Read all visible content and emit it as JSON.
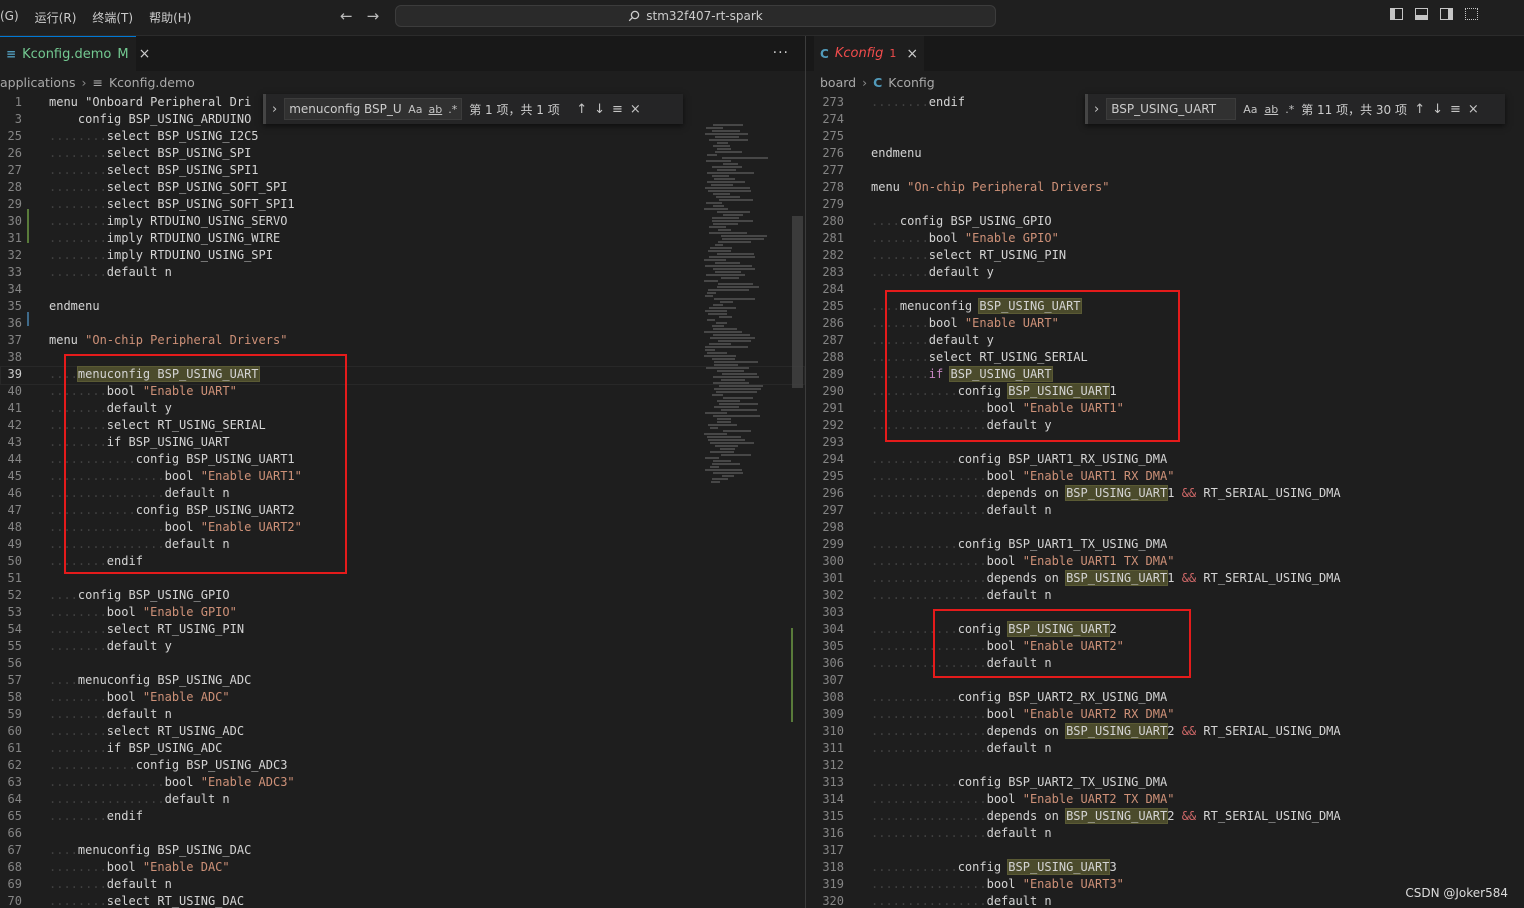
{
  "menubar": {
    "items": [
      "(G)",
      "运行(R)",
      "终端(T)",
      "帮助(H)"
    ]
  },
  "nav": {
    "back": "←",
    "forward": "→"
  },
  "command_center": {
    "label": "stm32f407-rt-spark"
  },
  "left": {
    "tab": {
      "label": "Kconfig.demo",
      "status": "M",
      "close": "×"
    },
    "more": "···",
    "breadcrumb": [
      "applications",
      "Kconfig.demo"
    ],
    "find": {
      "query": "menuconfig BSP_U:",
      "opt_case": "Aa",
      "opt_word": "ab",
      "opt_regex": ".*",
      "result": "第 1 项，共 1 项"
    },
    "lines": [
      {
        "n": "1",
        "t": "menu \"Onboard Peripheral Dri"
      },
      {
        "n": "3",
        "t": "    config BSP_USING_ARDUINO"
      },
      {
        "n": "25",
        "t": "........select BSP_USING_I2C5"
      },
      {
        "n": "26",
        "t": "........select BSP_USING_SPI"
      },
      {
        "n": "27",
        "t": "........select BSP_USING_SPI1"
      },
      {
        "n": "28",
        "t": "........select BSP_USING_SOFT_SPI"
      },
      {
        "n": "29",
        "t": "........select BSP_USING_SOFT_SPI1"
      },
      {
        "n": "30",
        "t": "........imply RTDUINO_USING_SERVO"
      },
      {
        "n": "31",
        "t": "........imply RTDUINO_USING_WIRE"
      },
      {
        "n": "32",
        "t": "........imply RTDUINO_USING_SPI"
      },
      {
        "n": "33",
        "t": "........default n"
      },
      {
        "n": "34",
        "t": ""
      },
      {
        "n": "35",
        "t": "endmenu"
      },
      {
        "n": "36",
        "t": ""
      },
      {
        "n": "37",
        "t": "menu \"On-chip Peripheral Drivers\""
      },
      {
        "n": "38",
        "t": ""
      },
      {
        "n": "39",
        "t": "....menuconfig BSP_USING_UART"
      },
      {
        "n": "40",
        "t": "........bool \"Enable UART\""
      },
      {
        "n": "41",
        "t": "........default y"
      },
      {
        "n": "42",
        "t": "........select RT_USING_SERIAL"
      },
      {
        "n": "43",
        "t": "........if BSP_USING_UART"
      },
      {
        "n": "44",
        "t": "............config BSP_USING_UART1"
      },
      {
        "n": "45",
        "t": "................bool \"Enable UART1\""
      },
      {
        "n": "46",
        "t": "................default n"
      },
      {
        "n": "47",
        "t": "............config BSP_USING_UART2"
      },
      {
        "n": "48",
        "t": "................bool \"Enable UART2\""
      },
      {
        "n": "49",
        "t": "................default n"
      },
      {
        "n": "50",
        "t": "........endif"
      },
      {
        "n": "51",
        "t": ""
      },
      {
        "n": "52",
        "t": "....config BSP_USING_GPIO"
      },
      {
        "n": "53",
        "t": "........bool \"Enable GPIO\""
      },
      {
        "n": "54",
        "t": "........select RT_USING_PIN"
      },
      {
        "n": "55",
        "t": "........default y"
      },
      {
        "n": "56",
        "t": ""
      },
      {
        "n": "57",
        "t": "....menuconfig BSP_USING_ADC"
      },
      {
        "n": "58",
        "t": "........bool \"Enable ADC\""
      },
      {
        "n": "59",
        "t": "........default n"
      },
      {
        "n": "60",
        "t": "........select RT_USING_ADC"
      },
      {
        "n": "61",
        "t": "........if BSP_USING_ADC"
      },
      {
        "n": "62",
        "t": "............config BSP_USING_ADC3"
      },
      {
        "n": "63",
        "t": "................bool \"Enable ADC3\""
      },
      {
        "n": "64",
        "t": "................default n"
      },
      {
        "n": "65",
        "t": "........endif"
      },
      {
        "n": "66",
        "t": ""
      },
      {
        "n": "67",
        "t": "....menuconfig BSP_USING_DAC"
      },
      {
        "n": "68",
        "t": "........bool \"Enable DAC\""
      },
      {
        "n": "69",
        "t": "........default n"
      },
      {
        "n": "70",
        "t": "........select RT_USING_DAC"
      }
    ]
  },
  "right": {
    "tab": {
      "label": "Kconfig",
      "status": "1",
      "close": "×"
    },
    "breadcrumb": [
      "board",
      "Kconfig"
    ],
    "find": {
      "query": "BSP_USING_UART",
      "opt_case": "Aa",
      "opt_word": "ab",
      "opt_regex": ".*",
      "result": "第 11 项，共 30 项"
    },
    "lines": [
      {
        "n": "273",
        "t": "........endif"
      },
      {
        "n": "274",
        "t": ""
      },
      {
        "n": "275",
        "t": ""
      },
      {
        "n": "276",
        "t": "endmenu"
      },
      {
        "n": "277",
        "t": ""
      },
      {
        "n": "278",
        "t": "menu \"On-chip Peripheral Drivers\""
      },
      {
        "n": "279",
        "t": ""
      },
      {
        "n": "280",
        "t": "....config BSP_USING_GPIO"
      },
      {
        "n": "281",
        "t": "........bool \"Enable GPIO\""
      },
      {
        "n": "282",
        "t": "........select RT_USING_PIN"
      },
      {
        "n": "283",
        "t": "........default y"
      },
      {
        "n": "284",
        "t": ""
      },
      {
        "n": "285",
        "t": "....menuconfig BSP_USING_UART"
      },
      {
        "n": "286",
        "t": "........bool \"Enable UART\""
      },
      {
        "n": "287",
        "t": "........default y"
      },
      {
        "n": "288",
        "t": "........select RT_USING_SERIAL"
      },
      {
        "n": "289",
        "t": "........if BSP_USING_UART"
      },
      {
        "n": "290",
        "t": "............config BSP_USING_UART1"
      },
      {
        "n": "291",
        "t": "................bool \"Enable UART1\""
      },
      {
        "n": "292",
        "t": "................default y"
      },
      {
        "n": "293",
        "t": ""
      },
      {
        "n": "294",
        "t": "............config BSP_UART1_RX_USING_DMA"
      },
      {
        "n": "295",
        "t": "................bool \"Enable UART1 RX DMA\""
      },
      {
        "n": "296",
        "t": "................depends on BSP_USING_UART1 && RT_SERIAL_USING_DMA"
      },
      {
        "n": "297",
        "t": "................default n"
      },
      {
        "n": "298",
        "t": ""
      },
      {
        "n": "299",
        "t": "............config BSP_UART1_TX_USING_DMA"
      },
      {
        "n": "300",
        "t": "................bool \"Enable UART1 TX DMA\""
      },
      {
        "n": "301",
        "t": "................depends on BSP_USING_UART1 && RT_SERIAL_USING_DMA"
      },
      {
        "n": "302",
        "t": "................default n"
      },
      {
        "n": "303",
        "t": ""
      },
      {
        "n": "304",
        "t": "............config BSP_USING_UART2"
      },
      {
        "n": "305",
        "t": "................bool \"Enable UART2\""
      },
      {
        "n": "306",
        "t": "................default n"
      },
      {
        "n": "307",
        "t": ""
      },
      {
        "n": "308",
        "t": "............config BSP_UART2_RX_USING_DMA"
      },
      {
        "n": "309",
        "t": "................bool \"Enable UART2 RX DMA\""
      },
      {
        "n": "310",
        "t": "................depends on BSP_USING_UART2 && RT_SERIAL_USING_DMA"
      },
      {
        "n": "311",
        "t": "................default n"
      },
      {
        "n": "312",
        "t": ""
      },
      {
        "n": "313",
        "t": "............config BSP_UART2_TX_USING_DMA"
      },
      {
        "n": "314",
        "t": "................bool \"Enable UART2 TX DMA\""
      },
      {
        "n": "315",
        "t": "................depends on BSP_USING_UART2 && RT_SERIAL_USING_DMA"
      },
      {
        "n": "316",
        "t": "................default n"
      },
      {
        "n": "317",
        "t": ""
      },
      {
        "n": "318",
        "t": "............config BSP_USING_UART3"
      },
      {
        "n": "319",
        "t": "................bool \"Enable UART3\""
      },
      {
        "n": "320",
        "t": "................default n"
      }
    ]
  },
  "watermark": "CSDN @Joker584",
  "colors": {
    "string": "#ce9178",
    "keyword_if": "#c586c0",
    "operator": "#d16969",
    "redbox": "#e51b1b",
    "modified_tab": "#73c991",
    "error_tab": "#f14c4c"
  }
}
